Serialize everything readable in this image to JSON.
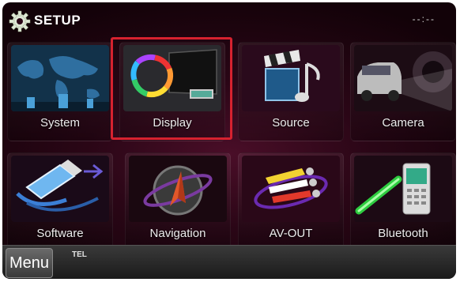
{
  "header": {
    "title": "SETUP",
    "clock": "--:--"
  },
  "tiles": [
    {
      "label": "System",
      "icon": "world-map-icon"
    },
    {
      "label": "Display",
      "icon": "display-monitor-icon"
    },
    {
      "label": "Source",
      "icon": "clapperboard-music-icon"
    },
    {
      "label": "Camera",
      "icon": "car-camera-icon"
    },
    {
      "label": "Software",
      "icon": "usb-drive-icon"
    },
    {
      "label": "Navigation",
      "icon": "navigation-arrow-icon"
    },
    {
      "label": "AV-OUT",
      "icon": "av-plugs-icon"
    },
    {
      "label": "Bluetooth",
      "icon": "bluetooth-phone-icon"
    }
  ],
  "selected_tile": "Display",
  "footer": {
    "menu_label": "Menu",
    "status_text": "TEL"
  },
  "colors": {
    "accent": "#d6222f",
    "background": "#2a0616"
  }
}
